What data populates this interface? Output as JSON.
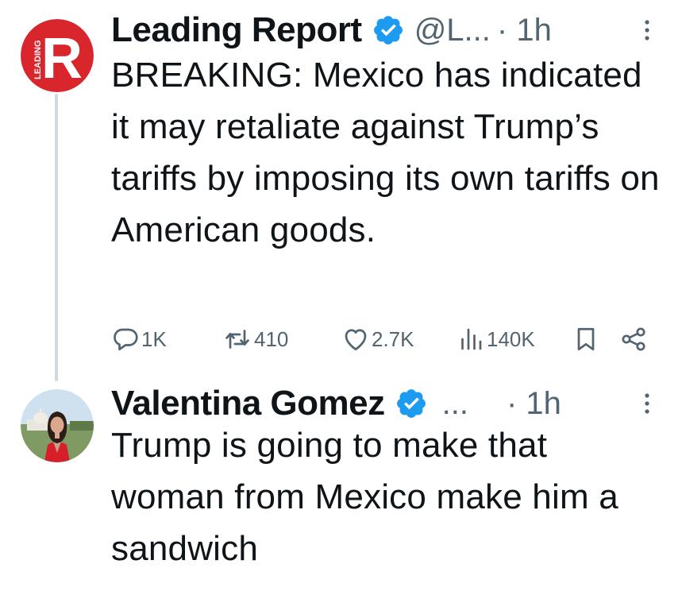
{
  "thread": [
    {
      "display_name": "Leading Report",
      "handle": "@L...",
      "time": "· 1h",
      "avatar_letter": "R",
      "avatar_text": "LEADING",
      "avatar_color": "#d9262c",
      "verified_color": "#1d9bf0",
      "text": "BREAKING: Mexico has indicated it may retaliate against Trump’s tariffs by imposing its own tariffs on American goods.",
      "actions": {
        "replies": "1K",
        "reposts": "410",
        "likes": "2.7K",
        "views": "140K"
      }
    },
    {
      "display_name": "Valentina Gomez",
      "handle": "...",
      "time": "· 1h",
      "verified_color": "#1d9bf0",
      "text": "Trump is going to make that woman from Mexico make him a sandwich"
    }
  ],
  "icons": {
    "reply": "reply-icon",
    "repost": "repost-icon",
    "like": "heart-icon",
    "views": "views-icon",
    "bookmark": "bookmark-icon",
    "share": "share-icon",
    "more": "more-vertical-icon",
    "verified": "verified-badge-icon"
  },
  "colors": {
    "text_primary": "#0f1419",
    "text_secondary": "#536471",
    "thread_line": "#cfd9de"
  }
}
